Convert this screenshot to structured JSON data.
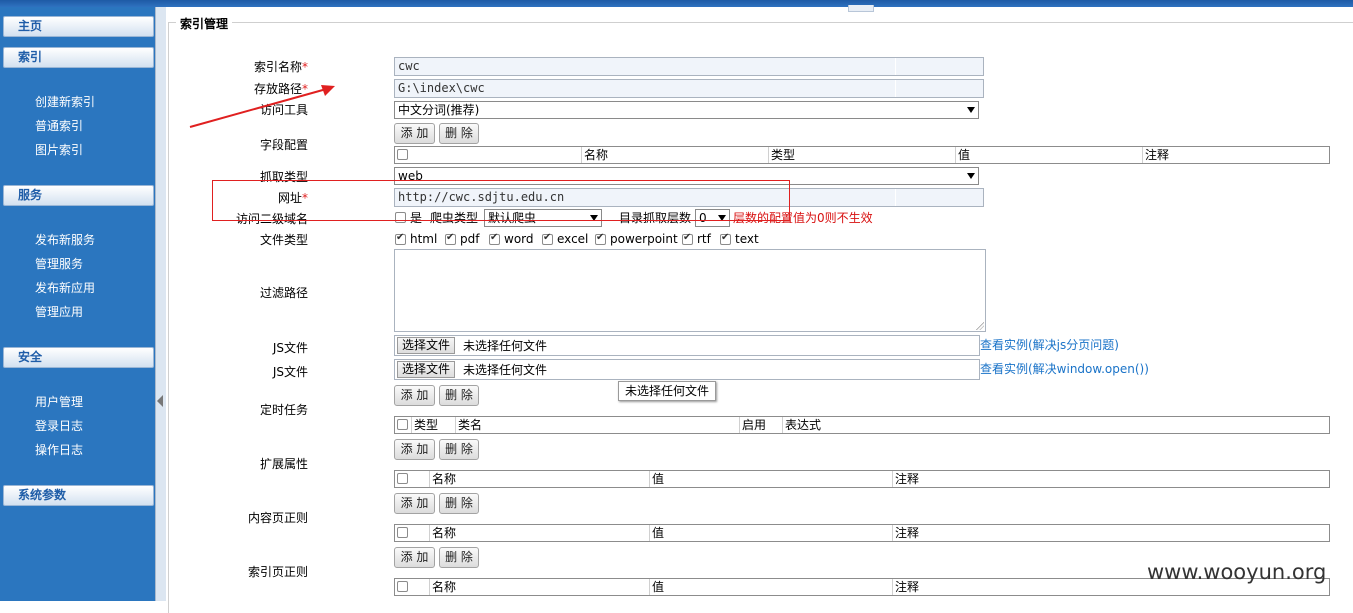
{
  "sidebar": {
    "home": "主页",
    "sections": [
      {
        "title": "索引",
        "items": [
          "创建新索引",
          "普通索引",
          "图片索引"
        ]
      },
      {
        "title": "服务",
        "items": [
          "发布新服务",
          "管理服务",
          "发布新应用",
          "管理应用"
        ]
      },
      {
        "title": "安全",
        "items": [
          "用户管理",
          "登录日志",
          "操作日志"
        ]
      },
      {
        "title": "系统参数",
        "items": []
      }
    ]
  },
  "form": {
    "legend": "索引管理",
    "labels": {
      "index_name": "索引名称",
      "store_path": "存放路径",
      "analyzer": "访问工具",
      "fields": "字段配置",
      "crawl_type": "抓取类型",
      "url": "网址",
      "subdomain": "访问二级域名",
      "file_types": "文件类型",
      "filter_path": "过滤路径",
      "js_file1": "JS文件",
      "js_file2": "JS文件",
      "schedule": "定时任务",
      "ext_props": "扩展属性",
      "content_regex": "内容页正则",
      "index_regex": "索引页正则"
    },
    "required_mark": "*",
    "values": {
      "index_name": "cwc",
      "store_path": "G:\\index\\cwc",
      "analyzer": "中文分词(推荐)",
      "crawl_type": "web",
      "url": "http://cwc.sdjtu.edu.cn"
    },
    "subdomain_row": {
      "yes": "是",
      "spider_type_label": "爬虫类型",
      "spider_type_value": "默认爬虫",
      "depth_label": "目录抓取层数",
      "depth_value": "0",
      "depth_warning": "层数的配置值为0则不生效"
    },
    "file_types": [
      "html",
      "pdf",
      "word",
      "excel",
      "powerpoint",
      "rtf",
      "text"
    ],
    "buttons": {
      "add": "添 加",
      "delete": "删 除"
    },
    "file_input": {
      "choose": "选择文件",
      "none": "未选择任何文件"
    },
    "links": {
      "js1": "查看实例(解决js分页问题)",
      "js2": "查看实例(解决window.open())"
    },
    "tooltip": "未选择任何文件",
    "field_table_headers": [
      "名称",
      "类型",
      "值",
      "注释"
    ],
    "schedule_table_headers": [
      "类型",
      "类名",
      "启用",
      "表达式"
    ],
    "kv_table_headers": [
      "名称",
      "值",
      "注释"
    ]
  },
  "watermark": "www.wooyun.org",
  "colors": {
    "sidebar": "#2b76bf",
    "annotation": "#e02020",
    "link": "#1a73c8"
  }
}
